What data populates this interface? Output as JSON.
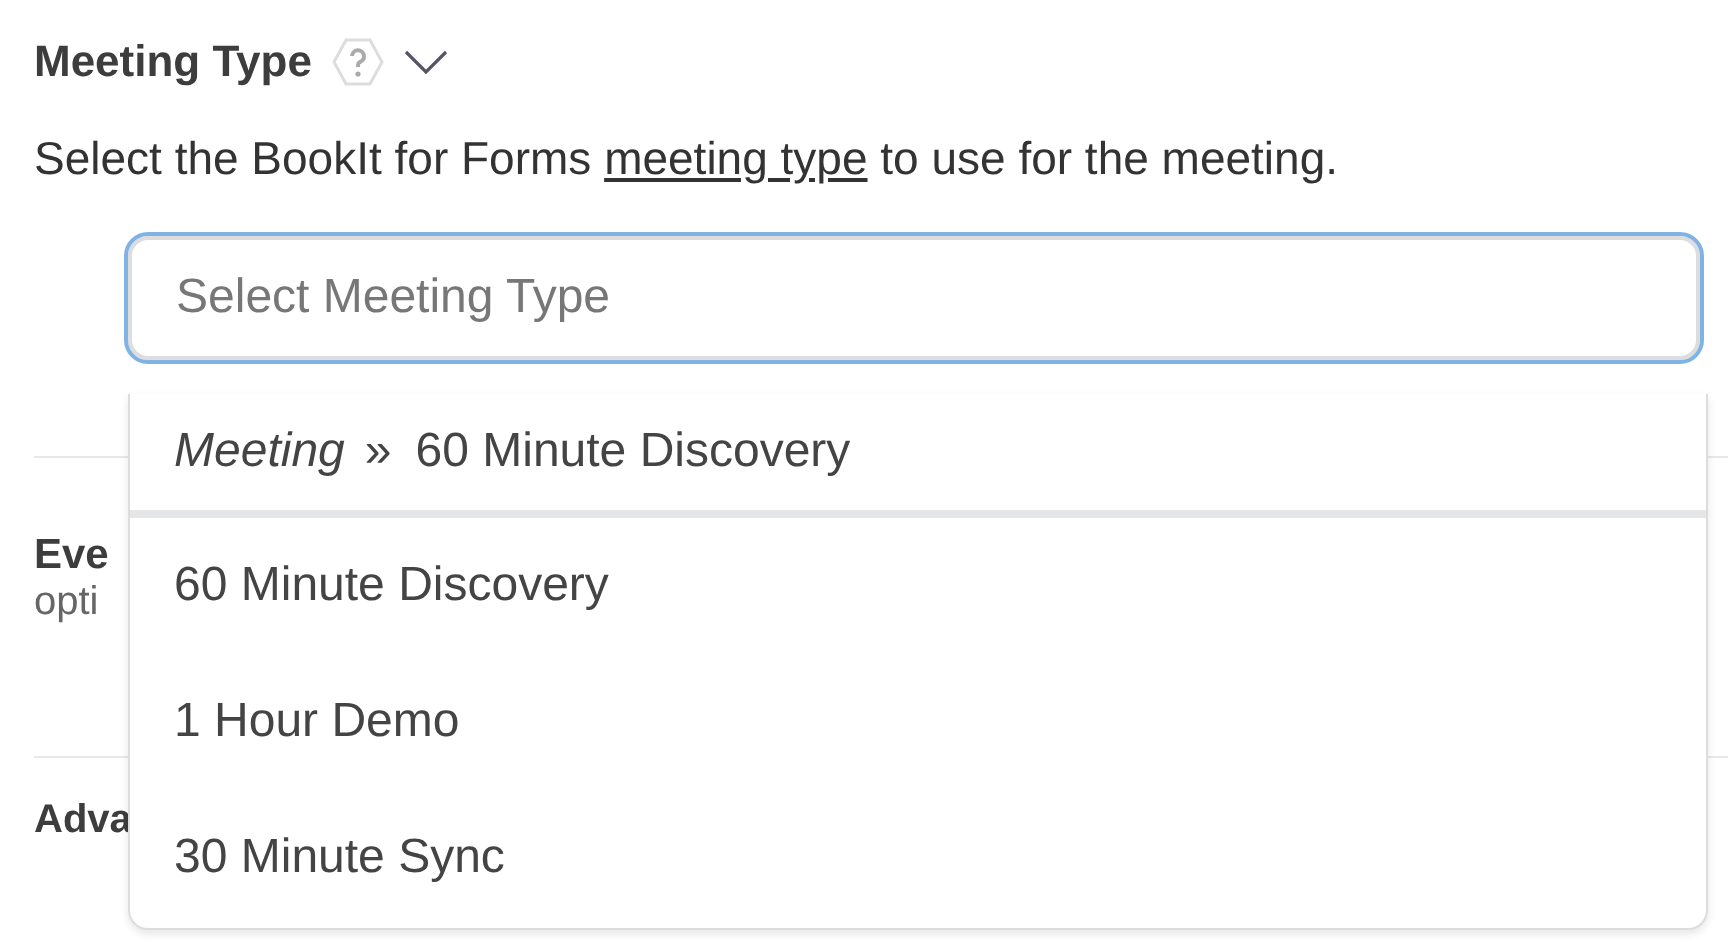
{
  "field": {
    "label": "Meeting Type",
    "description_before": "Select the BookIt for Forms ",
    "description_link": "meeting type",
    "description_after": " to use for the meeting.",
    "placeholder": "Select Meeting Type"
  },
  "dropdown": {
    "options": [
      {
        "kind": "path",
        "group": "Meeting",
        "separator": "»",
        "label": "60 Minute Discovery"
      },
      {
        "kind": "plain",
        "label": "60 Minute Discovery"
      },
      {
        "kind": "plain",
        "label": "1 Hour Demo"
      },
      {
        "kind": "plain",
        "label": "30 Minute Sync"
      }
    ]
  },
  "background": {
    "section_title": "Eve",
    "section_text": "opti",
    "advanced_title": "Adva"
  }
}
